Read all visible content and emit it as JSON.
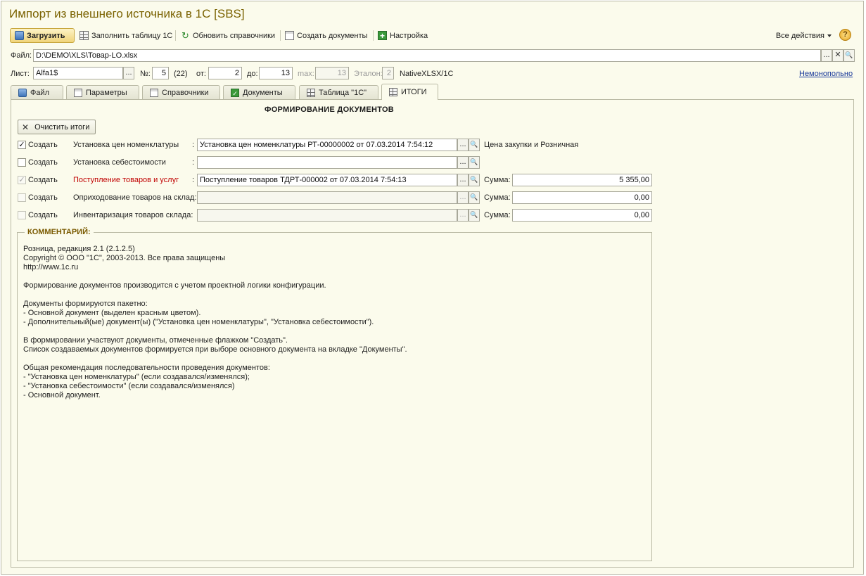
{
  "window": {
    "title": "Импорт из внешнего источника в 1С [SBS]"
  },
  "toolbar": {
    "load_label": "Загрузить",
    "fill_table_label": "Заполнить таблицу 1С",
    "update_refs_label": "Обновить справочники",
    "create_docs_label": "Создать документы",
    "settings_label": "Настройка",
    "all_actions_label": "Все действия",
    "help_label": "?"
  },
  "file": {
    "label": "Файл:",
    "path": "D:\\DEMO\\XLS\\Товар-LO.xlsx",
    "select_label": "...",
    "clear_label": "✕",
    "open_label": "🔍"
  },
  "sheet": {
    "label": "Лист:",
    "value": "Alfa1$",
    "select_label": "...",
    "num_label": "№:",
    "num_value": "5",
    "num_total": "(22)",
    "from_label": "от:",
    "from_value": "2",
    "to_label": "до:",
    "to_value": "13",
    "max_label": "max:",
    "max_value": "13",
    "etalon_label": "Эталон:",
    "etalon_value": "2",
    "format": "NativeXLSX/1C",
    "mode_link": "Немонопольно"
  },
  "tabs": [
    {
      "label": "Файл",
      "icon": "file-icon"
    },
    {
      "label": "Параметры",
      "icon": "params-icon"
    },
    {
      "label": "Справочники",
      "icon": "catalogs-icon"
    },
    {
      "label": "Документы",
      "icon": "documents-icon"
    },
    {
      "label": "Таблица \"1С\"",
      "icon": "table-icon"
    },
    {
      "label": "ИТОГИ",
      "icon": "totals-icon"
    }
  ],
  "results": {
    "section_title": "ФОРМИРОВАНИЕ ДОКУМЕНТОВ",
    "clear_button": "Очистить итоги",
    "rows": [
      {
        "create_label": "Создать",
        "checked": true,
        "doc_type": "Установка цен номенклатуры",
        "colon": ":",
        "value": "Установка цен номенклатуры РТ-00000002 от 07.03.2014 7:54:12",
        "extra": "Цена закупки и Розничная"
      },
      {
        "create_label": "Создать",
        "checked": false,
        "doc_type": "Установка себестоимости",
        "colon": ":",
        "value": "",
        "extra": ""
      },
      {
        "create_label": "Создать",
        "checked": true,
        "doc_type": "Поступление товаров и услуг",
        "colon": ":",
        "value": "Поступление товаров ТДРТ-000002 от 07.03.2014 7:54:13",
        "sum_label": "Сумма:",
        "sum": "5 355,00"
      },
      {
        "create_label": "Создать",
        "checked": false,
        "doc_type": "Оприходование товаров на склад:",
        "value": "",
        "sum_label": "Сумма:",
        "sum": "0,00"
      },
      {
        "create_label": "Создать",
        "checked": false,
        "doc_type": "Инвентаризация товаров склада:",
        "value": "",
        "sum_label": "Сумма:",
        "sum": "0,00"
      }
    ],
    "select_label": "...",
    "search_label": "🔍"
  },
  "comment": {
    "title": "КОММЕНТАРИЙ:",
    "text": "Розница, редакция 2.1 (2.1.2.5)\nCopyright © ООО \"1С\", 2003-2013. Все права защищены\nhttp://www.1c.ru\n\nФормирование документов производится с учетом проектной логики конфигурации.\n\nДокументы формируются пакетно:\n- Основной документ (выделен красным цветом).\n- Дополнительный(ые) документ(ы) (\"Установка цен номенклатуры\", \"Установка себестоимости\").\n\nВ формировании участвуют документы, отмеченные флажком \"Создать\".\nСписок создаваемых документов формируется при выборе основного документа на вкладке \"Документы\".\n\nОбщая рекомендация последовательности проведения документов:\n- \"Установка цен номенклатуры\" (если создавался/изменялся);\n- \"Установка себестоимости\" (если создавался/изменялся)\n- Основной документ."
  }
}
